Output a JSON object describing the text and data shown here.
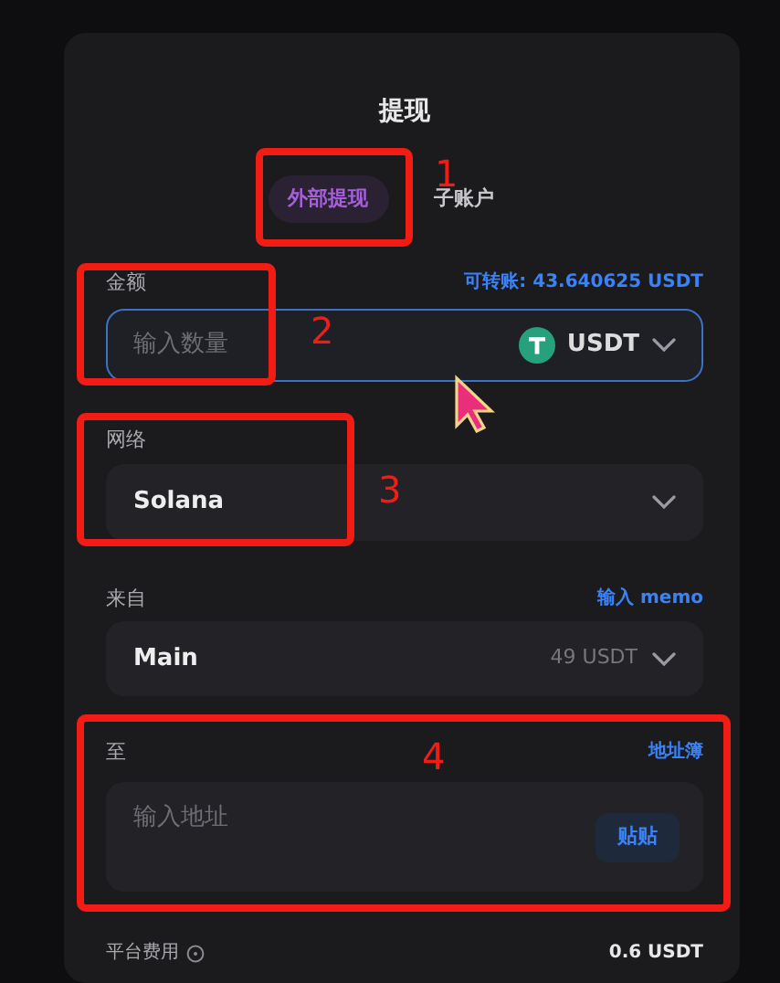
{
  "title": "提现",
  "tabs": [
    {
      "label": "外部提现",
      "selected": true
    },
    {
      "label": "子账户",
      "selected": false
    }
  ],
  "fields": [
    {
      "kind": "amount",
      "label": "金额",
      "link": "可转账: 43.640625 USDT",
      "placeholder": "输入数量",
      "currency": "USDT",
      "focused": true
    },
    {
      "kind": "select",
      "label": "网络",
      "value": "Solana"
    },
    {
      "kind": "select",
      "label": "来自",
      "link": "输入 memo",
      "value": "Main",
      "note": "49 USDT"
    },
    {
      "kind": "address",
      "label": "至",
      "link": "地址簿",
      "placeholder": "输入地址",
      "button": "贴贴"
    }
  ],
  "fee": {
    "label": "平台费用",
    "value": "0.6 USDT"
  },
  "annotations": [
    {
      "label": "1"
    },
    {
      "label": "2"
    },
    {
      "label": "3"
    },
    {
      "label": "4"
    }
  ]
}
